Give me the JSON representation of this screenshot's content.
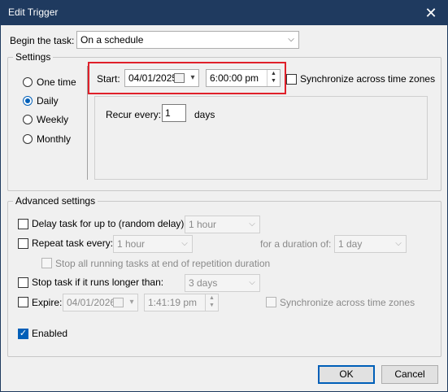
{
  "window": {
    "title": "Edit Trigger",
    "close_glyph": "✕"
  },
  "begin": {
    "label": "Begin the task:",
    "value": "On a schedule"
  },
  "settings": {
    "title": "Settings",
    "radios": [
      {
        "label": "One time",
        "selected": false
      },
      {
        "label": "Daily",
        "selected": true
      },
      {
        "label": "Weekly",
        "selected": false
      },
      {
        "label": "Monthly",
        "selected": false
      }
    ],
    "start_label": "Start:",
    "start_date": "04/01/2025",
    "start_time": "6:00:00 pm",
    "sync_label": "Synchronize across time zones",
    "recur_label": "Recur every:",
    "recur_value": "1",
    "recur_unit": "days"
  },
  "advanced": {
    "title": "Advanced settings",
    "delay_label": "Delay task for up to (random delay):",
    "delay_value": "1 hour",
    "repeat_label": "Repeat task every:",
    "repeat_value": "1 hour",
    "duration_label": "for a duration of:",
    "duration_value": "1 day",
    "stop_running_label": "Stop all running tasks at end of repetition duration",
    "stop_longer_label": "Stop task if it runs longer than:",
    "stop_longer_value": "3 days",
    "expire_label": "Expire:",
    "expire_date": "04/01/2026",
    "expire_time": "1:41:19 pm",
    "expire_sync_label": "Synchronize across time zones",
    "enabled_label": "Enabled"
  },
  "buttons": {
    "ok": "OK",
    "cancel": "Cancel"
  },
  "colors": {
    "titlebar": "#1f3a5f",
    "accent": "#005fb8",
    "highlight": "#e0202a"
  }
}
